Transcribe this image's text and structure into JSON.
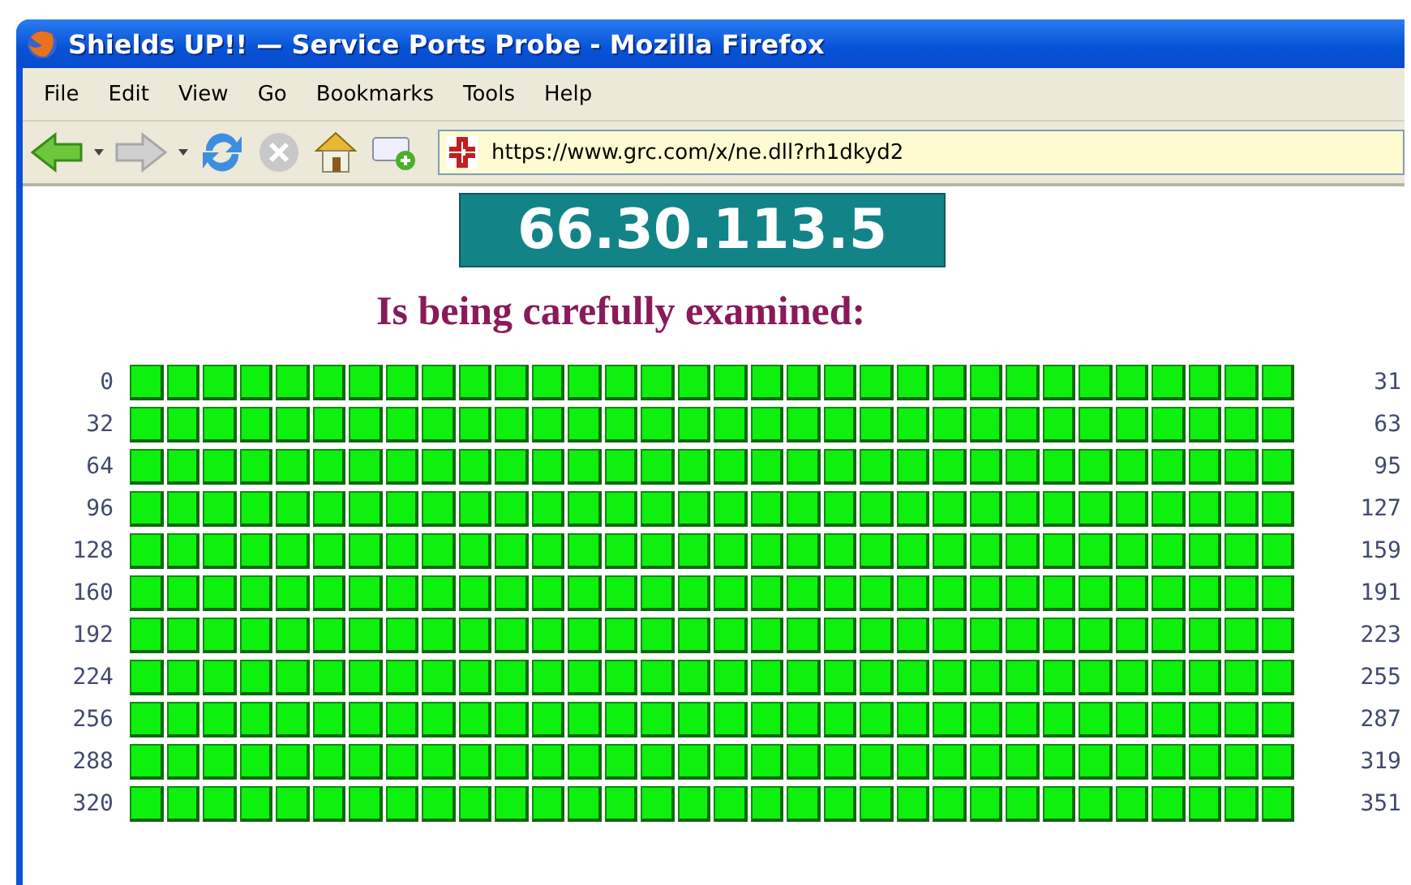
{
  "window": {
    "title": "Shields UP!! — Service Ports Probe - Mozilla Firefox"
  },
  "menu": [
    "File",
    "Edit",
    "View",
    "Go",
    "Bookmarks",
    "Tools",
    "Help"
  ],
  "address": {
    "value": "https://www.grc.com/x/ne.dll?rh1dkyd2",
    "secure": true
  },
  "page": {
    "ip": "66.30.113.5",
    "subtitle": "Is being carefully examined:",
    "rows": [
      {
        "start": "0",
        "end": "31",
        "color": "#0ef00e"
      },
      {
        "start": "32",
        "end": "63",
        "color": "#0ef00e"
      },
      {
        "start": "64",
        "end": "95",
        "color": "#0ef00e"
      },
      {
        "start": "96",
        "end": "127",
        "color": "#0ef00e"
      },
      {
        "start": "128",
        "end": "159",
        "color": "#0ef00e"
      },
      {
        "start": "160",
        "end": "191",
        "color": "#0ef00e"
      },
      {
        "start": "192",
        "end": "223",
        "color": "#0ef00e"
      },
      {
        "start": "224",
        "end": "255",
        "color": "#0ef00e"
      },
      {
        "start": "256",
        "end": "287",
        "color": "#0ef00e"
      },
      {
        "start": "288",
        "end": "319",
        "color": "#0ef00e"
      },
      {
        "start": "320",
        "end": "351",
        "color": "#0ef00e"
      }
    ]
  }
}
